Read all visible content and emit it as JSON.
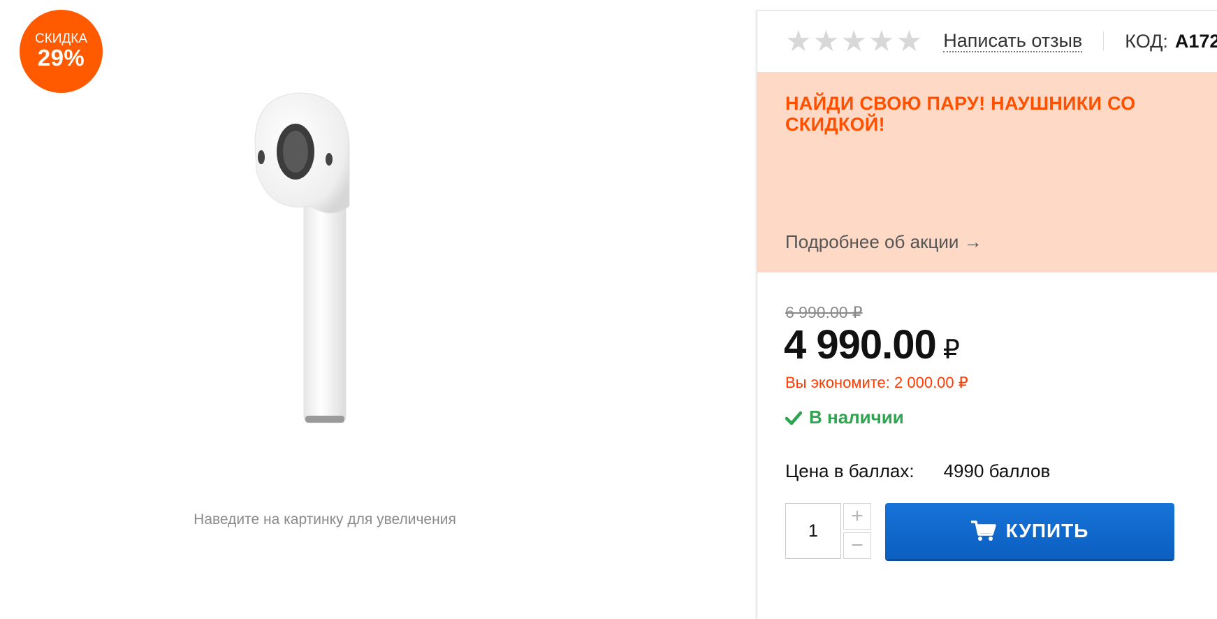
{
  "badge": {
    "label": "СКИДКА",
    "value": "29%"
  },
  "gallery": {
    "zoom_hint": "Наведите на картинку для увеличения",
    "image_icon": "airpod-earbud-image"
  },
  "rating": {
    "stars_filled": 0,
    "stars_total": 5,
    "review_link": "Написать отзыв"
  },
  "product_code": {
    "label": "КОД:",
    "value": "A172"
  },
  "promo": {
    "title": "НАЙДИ СВОЮ ПАРУ! НАУШНИКИ СО СКИДКОЙ!",
    "more_link": "Подробнее об акции →"
  },
  "pricing": {
    "old_price": "6 990.00 ₽",
    "price": "4 990.00",
    "currency": "₽",
    "savings": "Вы экономите: 2 000.00 ₽"
  },
  "stock": {
    "status": "В наличии",
    "icon": "check-icon"
  },
  "points": {
    "label": "Цена в баллах:",
    "value": "4990 баллов"
  },
  "purchase": {
    "quantity": "1",
    "plus": "+",
    "minus": "−",
    "buy_label": "КУПИТЬ",
    "buy_icon": "cart-icon"
  },
  "colors": {
    "accent": "#ff5a00",
    "promo_bg": "#fdd9c6",
    "button": "#1773d8",
    "in_stock": "#2ea44f"
  }
}
